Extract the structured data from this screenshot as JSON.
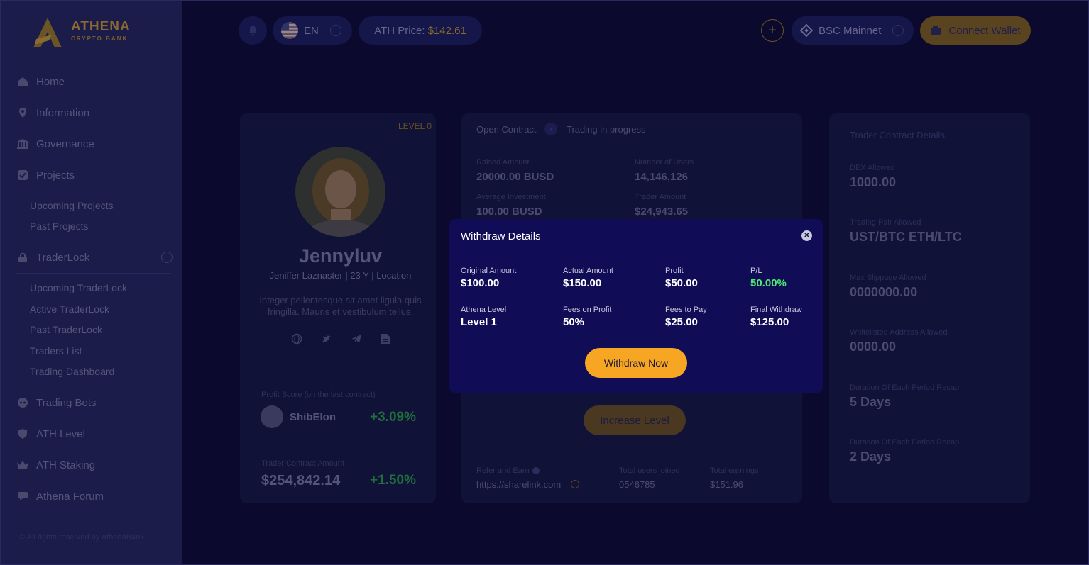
{
  "brand": {
    "name": "ATHENA",
    "tagline": "CRYPTO BANK"
  },
  "sidebar": {
    "items": [
      {
        "label": "Home",
        "icon": "home-icon"
      },
      {
        "label": "Information",
        "icon": "pin-icon"
      },
      {
        "label": "Governance",
        "icon": "bank-icon"
      },
      {
        "label": "Projects",
        "icon": "check-square-icon"
      },
      {
        "label": "TraderLock",
        "icon": "lock-icon"
      },
      {
        "label": "Trading Bots",
        "icon": "bot-icon"
      },
      {
        "label": "ATH Level",
        "icon": "shield-icon"
      },
      {
        "label": "ATH Staking",
        "icon": "crown-icon"
      },
      {
        "label": "Athena Forum",
        "icon": "chat-icon"
      }
    ],
    "projects_sub": [
      "Upcoming Projects",
      "Past Projects"
    ],
    "traderlock_sub": [
      "Upcoming TraderLock",
      "Active TraderLock",
      "Past TraderLock",
      "Traders List",
      "Trading Dashboard"
    ],
    "copyright": "© All rights reserved by AthenaBank"
  },
  "topbar": {
    "language": "EN",
    "price_label": "ATH Price:",
    "price_value": "$142.61",
    "network": "BSC Mainnet",
    "connect_wallet": "Connect Wallet"
  },
  "profile": {
    "level": "LEVEL 0",
    "name": "Jennyluv",
    "meta": "Jeniffer Laznaster | 23 Y | Location",
    "description": "Integer pellentesque sit amet ligula quis fringilla. Mauris et vestibulum tellus.",
    "profit_score_label": "Profit Score (on the last contract)",
    "coin_name": "ShibElon",
    "coin_change": "+3.09%",
    "contract_amount_label": "Trader Contract Amount",
    "contract_amount": "$254,842.14",
    "contract_change": "+1.50%"
  },
  "contract": {
    "breadcrumb_1": "Open Contract",
    "breadcrumb_2": "Trading in progress",
    "raised_label": "Raised Amount",
    "raised_value": "20000.00 BUSD",
    "users_label": "Number of Users",
    "users_value": "14,146,126",
    "avg_label": "Average Investment",
    "avg_value": "100.00 BUSD",
    "trader_amount_label": "Trader Amount",
    "trader_amount_value": "$24,943.65",
    "increase_level": "Increase Level",
    "refer_label": "Refer and Earn",
    "refer_link": "https://sharelink.com",
    "joined_label": "Total users joined",
    "joined_value": "0546785",
    "earnings_label": "Total earnings",
    "earnings_value": "$151.96"
  },
  "details": {
    "title": "Trader Contract Details",
    "rows": [
      {
        "label": "DEX Allowed",
        "value": "1000.00"
      },
      {
        "label": "Trading Pair Allowed",
        "value": "UST/BTC ETH/LTC"
      },
      {
        "label": "Max Slippage Allowed",
        "value": "0000000.00"
      },
      {
        "label": "Whitelisted Address Allowed",
        "value": "0000.00"
      },
      {
        "label": "Duration Of Each Period Recap",
        "value": "5 Days"
      },
      {
        "label": "Duration Of Each Period Recap",
        "value": "2 Days"
      }
    ]
  },
  "modal": {
    "title": "Withdraw Details",
    "cells": [
      {
        "label": "Original Amount",
        "value": "$100.00"
      },
      {
        "label": "Actual Amount",
        "value": "$150.00"
      },
      {
        "label": "Profit",
        "value": "$50.00"
      },
      {
        "label": "P/L",
        "value": "50.00%"
      },
      {
        "label": "Athena Level",
        "value": "Level 1"
      },
      {
        "label": "Fees on Profit",
        "value": "50%"
      },
      {
        "label": "Fees to Pay",
        "value": "$25.00"
      },
      {
        "label": "Final Withdraw",
        "value": "$125.00"
      }
    ],
    "button": "Withdraw Now"
  },
  "colors": {
    "accent": "#f6a623",
    "positive": "#4ee872",
    "modal_bg": "#100c55",
    "page_bg": "#0b0a2e"
  }
}
